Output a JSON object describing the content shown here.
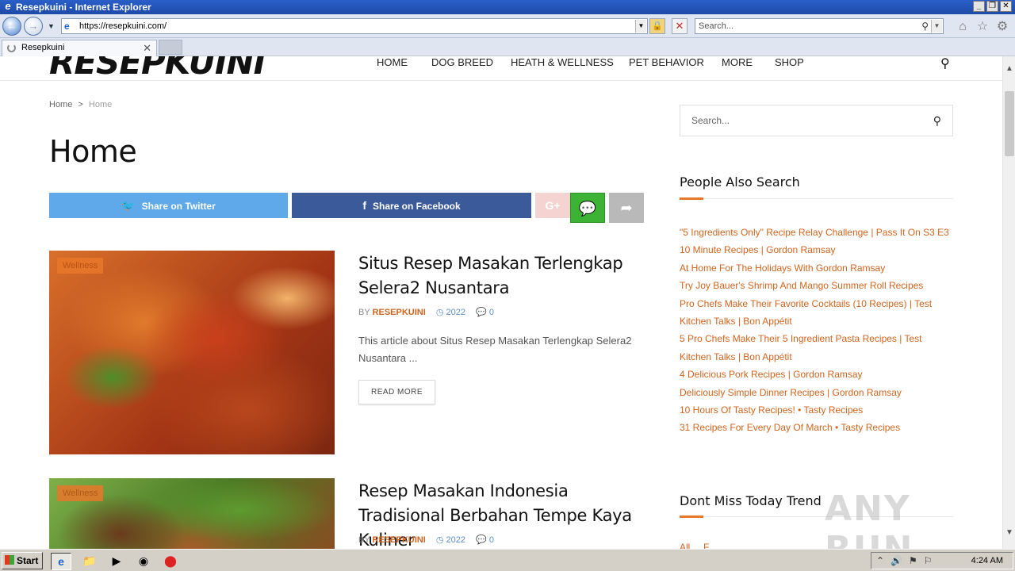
{
  "window": {
    "title": "Resepkuini - Internet Explorer",
    "url": "https://resepkuini.com/",
    "search_placeholder": "Search...",
    "tab_label": "Resepkuini"
  },
  "site": {
    "logo": "RESEPKUINI",
    "nav": [
      "HOME",
      "DOG BREED",
      "HEATH & WELLNESS",
      "PET BEHAVIOR",
      "MORE",
      "SHOP"
    ]
  },
  "breadcrumb": {
    "home": "Home",
    "sep": ">",
    "current": "Home"
  },
  "page_title": "Home",
  "share": {
    "twitter": "Share on Twitter",
    "facebook": "Share on Facebook"
  },
  "articles": [
    {
      "badge": "Wellness",
      "title": "Situs Resep Masakan Terlengkap Selera2 Nusantara",
      "by": "BY",
      "author": "RESEPKUINI",
      "date": "2022",
      "comments": "0",
      "excerpt": "This article about Situs Resep Masakan Terlengkap Selera2 Nusantara ...",
      "read_more": "READ MORE"
    },
    {
      "badge": "Wellness",
      "title": "Resep Masakan Indonesia Tradisional Berbahan Tempe Kaya Kuliner",
      "by": "BY",
      "author": "RESEPKUINI",
      "date": "2022",
      "comments": "0"
    }
  ],
  "sidebar": {
    "search_placeholder": "Search...",
    "people_also_search_title": "People Also Search",
    "links": [
      "\"5 Ingredients Only\" Recipe Relay Challenge | Pass It On S3 E3",
      "10 Minute Recipes | Gordon Ramsay",
      "At Home For The Holidays With Gordon Ramsay",
      "Try Joy Bauer's Shrimp And Mango Summer Roll Recipes",
      "Pro Chefs Make Their Favorite Cocktails (10 Recipes) | Test Kitchen Talks | Bon Appétit",
      "5 Pro Chefs Make Their 5 Ingredient Pasta Recipes | Test Kitchen Talks | Bon Appétit",
      "4 Delicious Pork Recipes | Gordon Ramsay",
      "Deliciously Simple Dinner Recipes | Gordon Ramsay",
      "10 Hours Of Tasty Recipes! • Tasty Recipes",
      "31 Recipes For Every Day Of March • Tasty Recipes"
    ],
    "trend_title": "Dont Miss Today Trend",
    "trend_partial": "All ... F..."
  },
  "watermark": "ANY RUN",
  "taskbar": {
    "start": "Start",
    "clock": "4:24 AM"
  },
  "icons": [
    "ie-logo-icon",
    "back-icon",
    "forward-icon",
    "lock-icon",
    "stop-icon",
    "magnifier-icon",
    "home-icon",
    "star-icon",
    "gear-icon",
    "twitter-icon",
    "facebook-icon",
    "google-plus-icon",
    "wechat-icon",
    "share-icon",
    "clock-icon",
    "comment-icon"
  ],
  "colors": {
    "accent": "#e8782a",
    "twitter": "#5fa8ea",
    "facebook": "#3b5a9a",
    "wechat": "#3db336"
  }
}
